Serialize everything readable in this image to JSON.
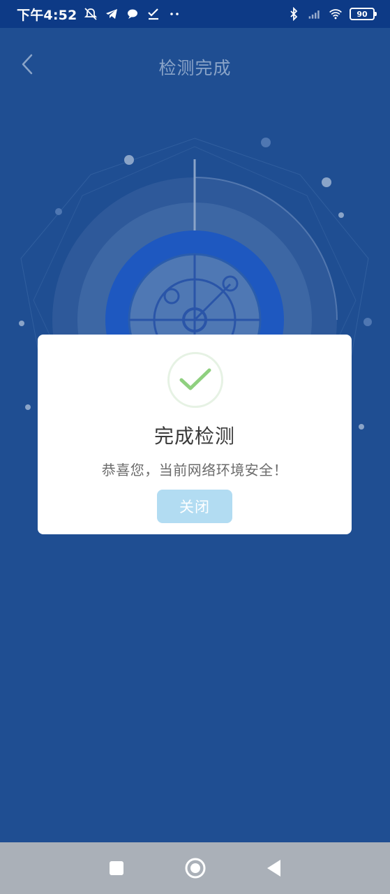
{
  "status_bar": {
    "time": "下午4:52",
    "battery": "90",
    "icons": [
      "alarm-off-icon",
      "telegram-icon",
      "chat-icon",
      "check-icon",
      "more-dots-icon",
      "bluetooth-icon",
      "signal-icon",
      "wifi-icon",
      "battery-icon"
    ]
  },
  "header": {
    "title": "检测完成",
    "back_icon": "back-arrow-icon"
  },
  "dialog": {
    "icon": "check-icon",
    "title": "完成检测",
    "message": "恭喜您，当前网络环境安全！",
    "close_label": "关闭",
    "colors": {
      "check": "#8fd07f",
      "button_bg": "#b2dcf2"
    }
  },
  "nav_bar": {
    "buttons": [
      "recent-apps-icon",
      "home-icon",
      "back-icon"
    ]
  },
  "colors": {
    "background": "#1f4e92",
    "status_bar": "#0d3a86",
    "nav_bar": "#aab0b8"
  }
}
